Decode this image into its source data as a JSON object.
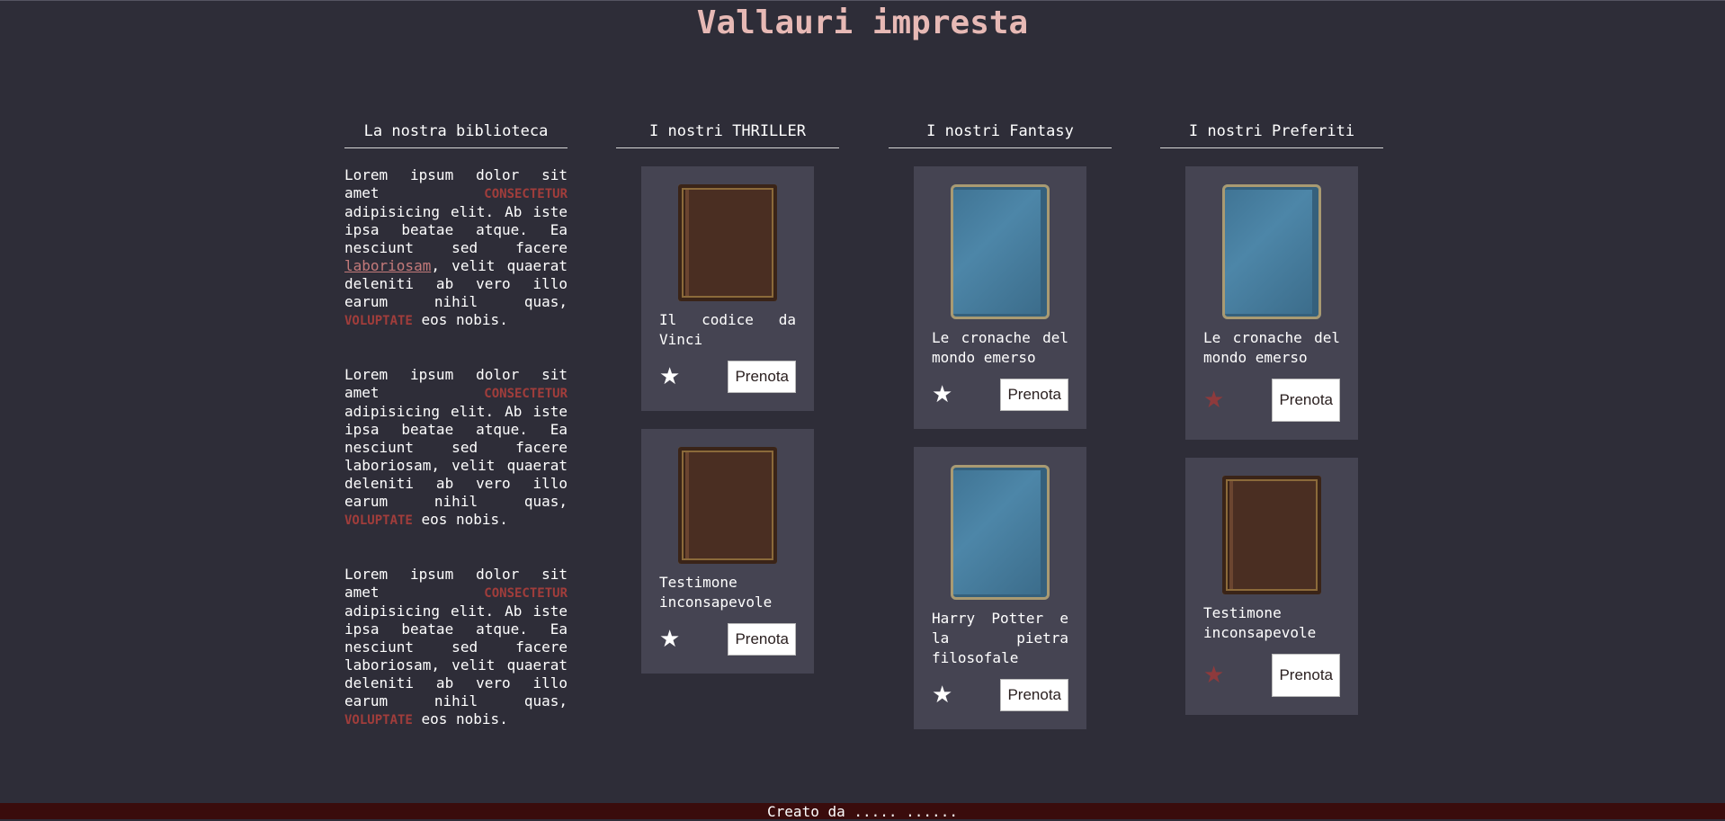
{
  "site": {
    "title": "Vallauri impresta"
  },
  "columns": {
    "library": {
      "heading": "La nostra biblioteca",
      "paragraphs": [
        {
          "a": "Lorem ipsum dolor sit amet ",
          "b": "CONSECTETUR",
          "c": " adipisicing elit. Ab iste ipsa beatae atque. Ea nesciunt sed facere ",
          "link": "laboriosam",
          "d": ", velit quaerat deleniti ab vero illo earum nihil quas, ",
          "e": "VOLUPTATE",
          "f": " eos nobis."
        },
        {
          "a": "Lorem ipsum dolor sit amet ",
          "b": "CONSECTETUR",
          "c": " adipisicing elit. Ab iste ipsa beatae atque. Ea nesciunt sed facere laboriosam, velit quaerat deleniti ab vero illo earum nihil quas, ",
          "e": "VOLUPTATE",
          "f": " eos nobis."
        },
        {
          "a": "Lorem ipsum dolor sit amet ",
          "b": "CONSECTETUR",
          "c": " adipisicing elit. Ab iste ipsa beatae atque. Ea nesciunt sed facere laboriosam, velit quaerat deleniti ab vero illo earum nihil quas, ",
          "e": "VOLUPTATE",
          "f": " eos nobis."
        }
      ]
    },
    "thriller": {
      "heading": "I nostri THRILLER",
      "books": [
        {
          "title": "Il codice da Vinci",
          "cover": "brown-book-cover",
          "star": "★",
          "button": "Prenota"
        },
        {
          "title": "Testimone inconsapevole",
          "cover": "brown-book-cover",
          "star": "★",
          "button": "Prenota"
        }
      ]
    },
    "fantasy": {
      "heading": "I nostri Fantasy",
      "books": [
        {
          "title": "Le cronache del mondo emerso",
          "cover": "blue-book-cover",
          "star": "★",
          "button": "Prenota"
        },
        {
          "title": "Harry Potter e la pietra filosofale",
          "cover": "blue-book-cover",
          "star": "★",
          "button": "Prenota"
        }
      ]
    },
    "favorites": {
      "heading": "I nostri Preferiti",
      "books": [
        {
          "title": "Le cronache del mondo emerso",
          "cover": "blue-book-cover",
          "star": "★",
          "button": "Prenota"
        },
        {
          "title": "Testimone inconsapevole",
          "cover": "brown-book-cover",
          "star": "★",
          "button": "Prenota"
        }
      ]
    }
  },
  "colors": {
    "background": "#2e2d38",
    "card": "#454452",
    "accent": "#a13d3b",
    "title": "#e7b9b5",
    "footer": "#3a0c0c",
    "favorite_star": "#8e3a3c"
  },
  "footer": {
    "text": "Creato da ..... ......"
  }
}
